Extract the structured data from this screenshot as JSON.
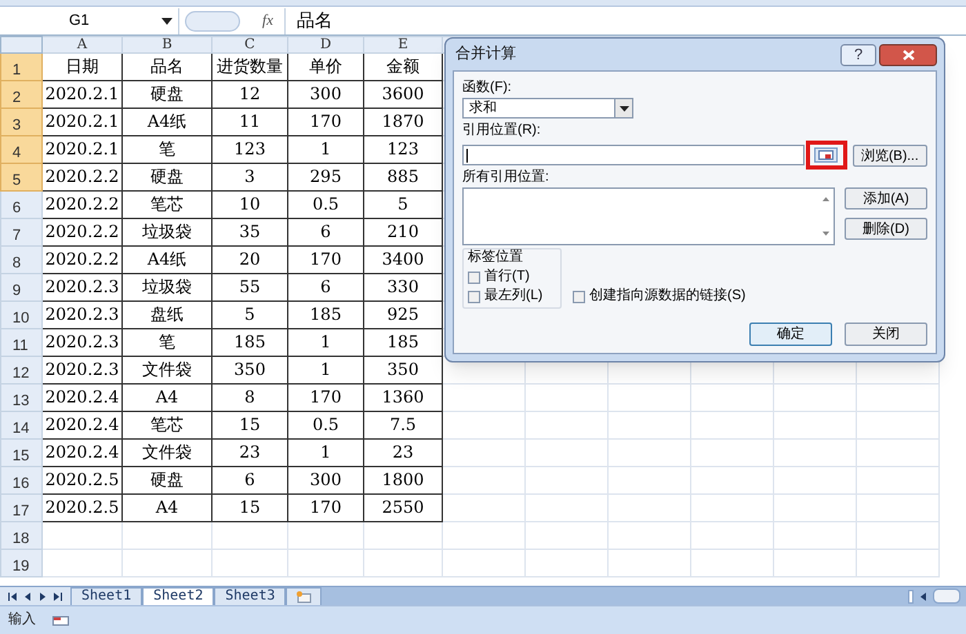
{
  "formula_bar": {
    "name_box": "G1",
    "fx": "fx",
    "content": "品名"
  },
  "columns": [
    {
      "label": "A"
    },
    {
      "label": "B"
    },
    {
      "label": "C"
    },
    {
      "label": "D"
    },
    {
      "label": "E"
    }
  ],
  "rows": [
    {
      "number": "1",
      "selected": true,
      "cells": [
        "日期",
        "品名",
        "进货数量",
        "单价",
        "金额"
      ]
    },
    {
      "number": "2",
      "selected": true,
      "cells": [
        "2020.2.1",
        "硬盘",
        "12",
        "300",
        "3600"
      ]
    },
    {
      "number": "3",
      "selected": true,
      "cells": [
        "2020.2.1",
        "A4纸",
        "11",
        "170",
        "1870"
      ]
    },
    {
      "number": "4",
      "selected": true,
      "cells": [
        "2020.2.1",
        "笔",
        "123",
        "1",
        "123"
      ]
    },
    {
      "number": "5",
      "selected": true,
      "cells": [
        "2020.2.2",
        "硬盘",
        "3",
        "295",
        "885"
      ]
    },
    {
      "number": "6",
      "selected": false,
      "cells": [
        "2020.2.2",
        "笔芯",
        "10",
        "0.5",
        "5"
      ]
    },
    {
      "number": "7",
      "selected": false,
      "cells": [
        "2020.2.2",
        "垃圾袋",
        "35",
        "6",
        "210"
      ]
    },
    {
      "number": "8",
      "selected": false,
      "cells": [
        "2020.2.2",
        "A4纸",
        "20",
        "170",
        "3400"
      ]
    },
    {
      "number": "9",
      "selected": false,
      "cells": [
        "2020.2.3",
        "垃圾袋",
        "55",
        "6",
        "330"
      ]
    },
    {
      "number": "10",
      "selected": false,
      "cells": [
        "2020.2.3",
        "盘纸",
        "5",
        "185",
        "925"
      ]
    },
    {
      "number": "11",
      "selected": false,
      "cells": [
        "2020.2.3",
        "笔",
        "185",
        "1",
        "185"
      ]
    },
    {
      "number": "12",
      "selected": false,
      "cells": [
        "2020.2.3",
        "文件袋",
        "350",
        "1",
        "350"
      ]
    },
    {
      "number": "13",
      "selected": false,
      "cells": [
        "2020.2.4",
        "A4",
        "8",
        "170",
        "1360"
      ]
    },
    {
      "number": "14",
      "selected": false,
      "cells": [
        "2020.2.4",
        "笔芯",
        "15",
        "0.5",
        "7.5"
      ]
    },
    {
      "number": "15",
      "selected": false,
      "cells": [
        "2020.2.4",
        "文件袋",
        "23",
        "1",
        "23"
      ]
    },
    {
      "number": "16",
      "selected": false,
      "cells": [
        "2020.2.5",
        "硬盘",
        "6",
        "300",
        "1800"
      ]
    },
    {
      "number": "17",
      "selected": false,
      "cells": [
        "2020.2.5",
        "A4",
        "15",
        "170",
        "2550"
      ]
    },
    {
      "number": "18",
      "selected": false,
      "cells": []
    },
    {
      "number": "19",
      "selected": false,
      "cells": []
    }
  ],
  "dialog": {
    "title": "合并计算",
    "help": "?",
    "function_label": "函数(F):",
    "function_value": "求和",
    "reference_label": "引用位置(R):",
    "browse": "浏览(B)...",
    "all_references_label": "所有引用位置:",
    "add": "添加(A)",
    "delete": "删除(D)",
    "label_group": "标签位置",
    "checkboxes": [
      {
        "label": "首行(T)",
        "checked": false
      },
      {
        "label": "最左列(L)",
        "checked": false
      },
      {
        "label": "创建指向源数据的链接(S)",
        "checked": false
      }
    ],
    "ok": "确定",
    "close": "关闭"
  },
  "sheet_tabs": [
    {
      "label": "Sheet1",
      "selected": false
    },
    {
      "label": "Sheet2",
      "selected": true
    },
    {
      "label": "Sheet3",
      "selected": false
    }
  ],
  "status_bar": {
    "mode": "输入"
  }
}
